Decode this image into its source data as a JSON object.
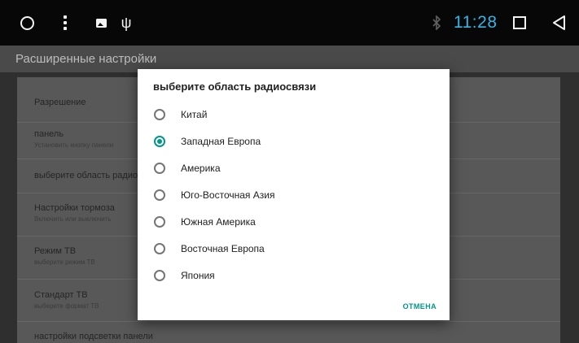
{
  "status_bar": {
    "time": "11:28",
    "time_color": "#33b5e5",
    "icons": [
      "circle-icon",
      "more-vert-icon",
      "image-icon",
      "usb-icon",
      "bluetooth-icon",
      "square-icon",
      "back-icon"
    ]
  },
  "app_bar": {
    "title": "Расширенные настройки"
  },
  "settings": {
    "items": [
      {
        "title": "Разрешение",
        "subtitle": ""
      },
      {
        "title": "панель",
        "subtitle": "Установить кнопку панели"
      },
      {
        "title": "выберите область радиосвязи",
        "subtitle": ""
      },
      {
        "title": "Настройки тормоза",
        "subtitle": "Включить или выключить"
      },
      {
        "title": "Режим ТВ",
        "subtitle": "выберите режим ТВ"
      },
      {
        "title": "Стандарт ТВ",
        "subtitle": "выберите формат ТВ"
      },
      {
        "title": "настройки подсветки панели",
        "subtitle": ""
      }
    ]
  },
  "dialog": {
    "title": "выберите область радиосвязи",
    "accent_color": "#009688",
    "selected": "Западная Европа",
    "options": [
      {
        "label": "Китай",
        "checked": false
      },
      {
        "label": "Западная Европа",
        "checked": true
      },
      {
        "label": "Америка",
        "checked": false
      },
      {
        "label": "Юго-Восточная Азия",
        "checked": false
      },
      {
        "label": "Южная Америка",
        "checked": false
      },
      {
        "label": "Восточная Европа",
        "checked": false
      },
      {
        "label": "Япония",
        "checked": false
      }
    ],
    "cancel_label": "ОТМЕНА"
  }
}
